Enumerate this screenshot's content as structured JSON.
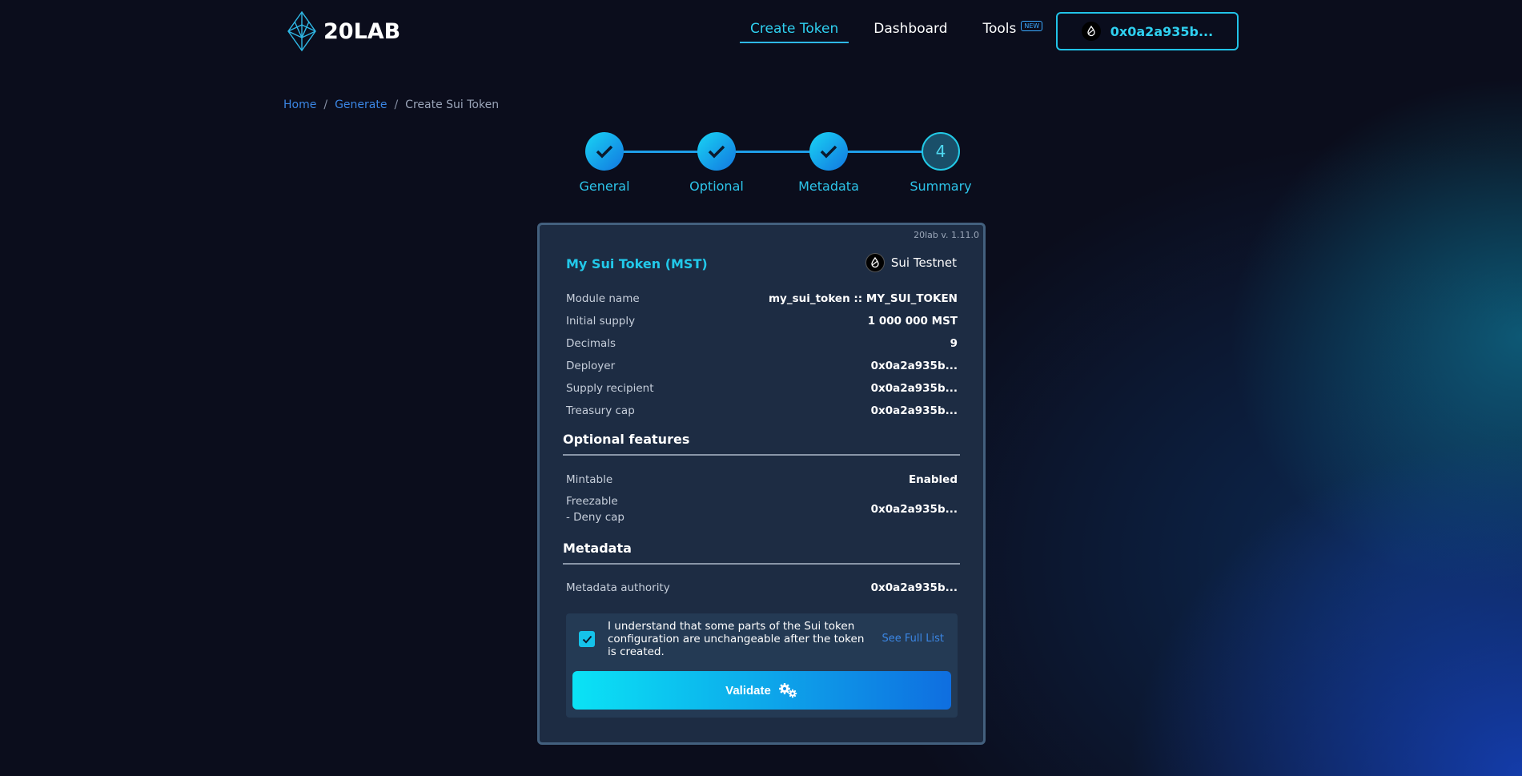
{
  "header": {
    "logo_text": "20LAB",
    "nav": [
      {
        "label": "Create Token",
        "active": true
      },
      {
        "label": "Dashboard",
        "active": false
      },
      {
        "label": "Tools",
        "active": false,
        "badge": "NEW"
      }
    ],
    "wallet_label": "0x0a2a935b..."
  },
  "breadcrumb": {
    "home": "Home",
    "generate": "Generate",
    "current": "Create Sui Token",
    "separator": "/"
  },
  "stepper": {
    "steps": [
      {
        "label": "General",
        "status": "done"
      },
      {
        "label": "Optional",
        "status": "done"
      },
      {
        "label": "Metadata",
        "status": "done"
      },
      {
        "label": "Summary",
        "status": "current",
        "number": "4"
      }
    ]
  },
  "card": {
    "version": "20lab v. 1.11.0",
    "token_title": "My Sui Token (MST)",
    "network": "Sui Testnet",
    "general_rows": [
      {
        "key": "Module name",
        "value": "my_sui_token :: MY_SUI_TOKEN"
      },
      {
        "key": "Initial supply",
        "value": "1 000 000 MST"
      },
      {
        "key": "Decimals",
        "value": "9"
      },
      {
        "key": "Deployer",
        "value": "0x0a2a935b..."
      },
      {
        "key": "Supply recipient",
        "value": "0x0a2a935b..."
      },
      {
        "key": "Treasury cap",
        "value": "0x0a2a935b..."
      }
    ],
    "optional_title": "Optional features",
    "mintable": {
      "key": "Mintable",
      "value": "Enabled"
    },
    "freezable": {
      "key": "Freezable",
      "subkey": "- Deny cap",
      "value": "0x0a2a935b..."
    },
    "metadata_title": "Metadata",
    "metadata_authority": {
      "key": "Metadata authority",
      "value": "0x0a2a935b..."
    },
    "confirm_text": "I understand that some parts of the Sui token configuration are unchangeable after the token is created.",
    "confirm_checked": true,
    "see_full_list": "See Full List",
    "validate_label": "Validate"
  },
  "colors": {
    "accent": "#22c9ea",
    "link": "#3b86e4",
    "card_bg": "#1d2c43"
  }
}
